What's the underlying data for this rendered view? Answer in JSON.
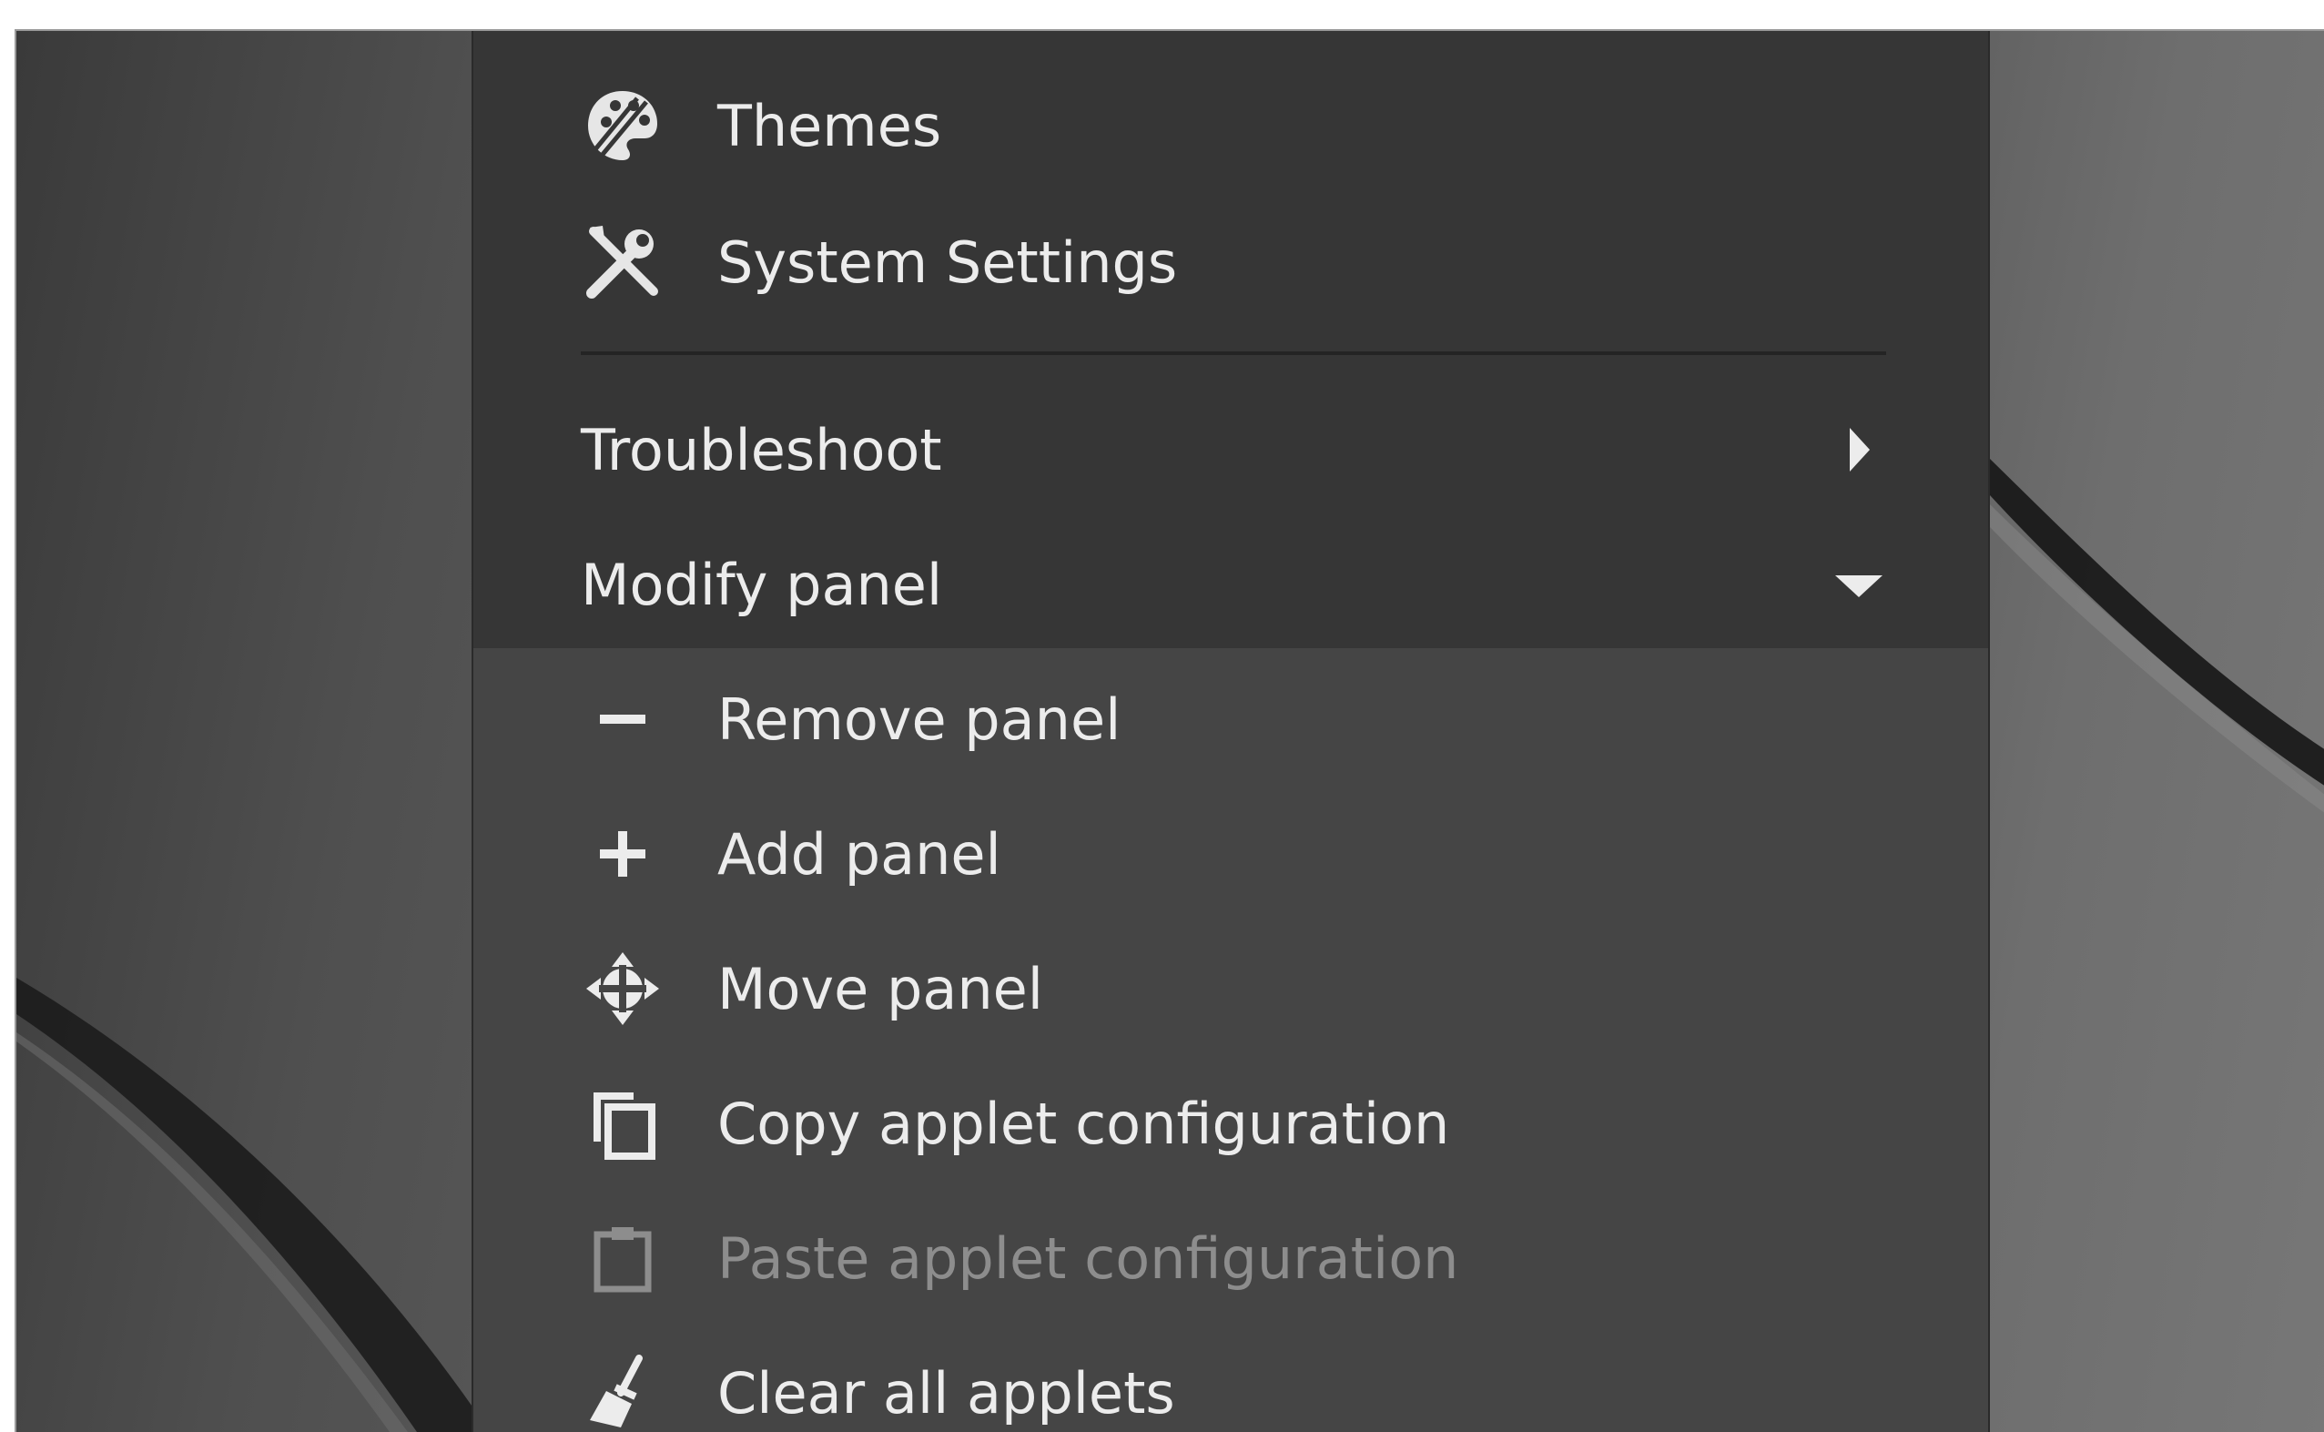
{
  "menu": {
    "themes_label": "Themes",
    "system_settings_label": "System Settings",
    "troubleshoot_label": "Troubleshoot",
    "modify_panel_label": "Modify panel",
    "submenu": {
      "remove_panel_label": "Remove panel",
      "add_panel_label": "Add panel",
      "move_panel_label": "Move panel",
      "copy_applet_config_label": "Copy applet configuration",
      "paste_applet_config_label": "Paste applet configuration",
      "clear_all_applets_label": "Clear all applets"
    }
  },
  "icons": {
    "themes": "palette-icon",
    "system_settings": "wrench-screwdriver-icon",
    "troubleshoot_arrow": "chevron-right-icon",
    "modify_panel_arrow": "chevron-down-icon",
    "remove_panel": "minus-icon",
    "add_panel": "plus-icon",
    "move_panel": "move-arrows-icon",
    "copy_applet": "copy-icon",
    "paste_applet": "clipboard-icon",
    "clear_applets": "broom-icon"
  },
  "colors": {
    "menu_bg": "#363636",
    "submenu_bg": "#454545",
    "text": "#ececec",
    "disabled_text": "#8d8d8d"
  }
}
